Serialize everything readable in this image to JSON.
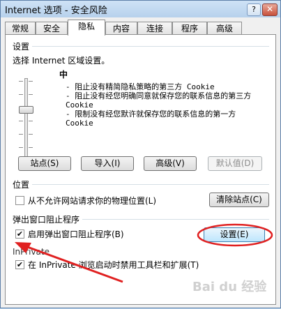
{
  "window": {
    "title": "Internet 选项 - 安全风险",
    "help": "?",
    "close": "✕"
  },
  "tabs": [
    "常规",
    "安全",
    "隐私",
    "内容",
    "连接",
    "程序",
    "高级"
  ],
  "active_tab": 2,
  "settings": {
    "header": "设置",
    "instruction": "选择 Internet 区域设置。",
    "level": "中",
    "descriptions": [
      "- 阻止没有精简隐私策略的第三方 Cookie",
      "- 阻止没有经您明确同意就保存您的联系信息的第三方 Cookie",
      "- 限制没有经您默许就保存您的联系信息的第一方 Cookie"
    ],
    "slider_level_fraction": 0.6
  },
  "buttons": {
    "sites": "站点(S)",
    "import": "导入(I)",
    "advanced": "高级(V)",
    "default": "默认值(D)",
    "clear_sites": "清除站点(C)",
    "popup_settings": "设置(E)"
  },
  "location": {
    "header": "位置",
    "checkbox_label": "从不允许网站请求你的物理位置(L)",
    "checked": false
  },
  "popup": {
    "header": "弹出窗口阻止程序",
    "checkbox_label": "启用弹出窗口阻止程序(B)",
    "checked": true
  },
  "inprivate": {
    "header": "InPrivate",
    "checkbox_label": "在 InPrivate 浏览启动时禁用工具栏和扩展(T)",
    "checked": true
  },
  "annotation": {
    "color": "#e02020"
  },
  "watermark": "Bai du 经验"
}
